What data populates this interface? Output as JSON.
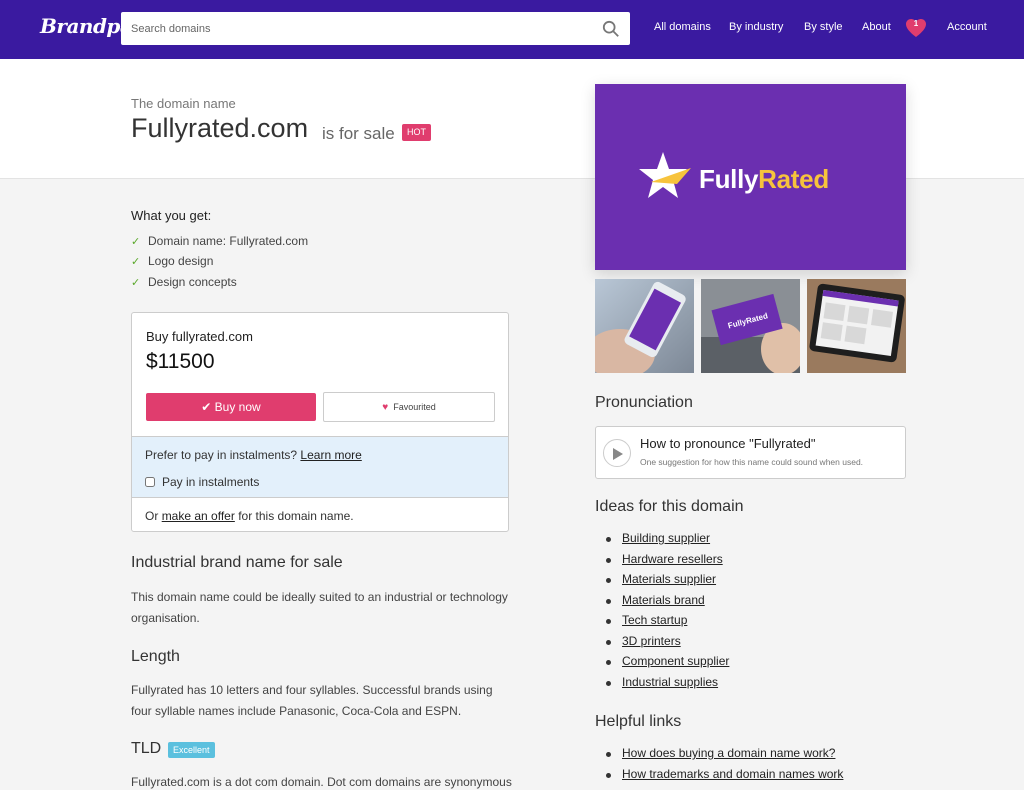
{
  "header": {
    "logo": "Brandpa",
    "search_placeholder": "Search domains",
    "nav": [
      "All domains",
      "By industry",
      "By style",
      "About"
    ],
    "favourites_count": "1",
    "account": "Account"
  },
  "hero": {
    "pre": "The domain name",
    "domain": "Fullyrated.com",
    "suffix": "is for sale",
    "badge": "HOT"
  },
  "logo_image": {
    "text_white": "Fully",
    "text_gold": "Rated",
    "bg_color": "#6b2fb0",
    "accent": "#f7c33c"
  },
  "mockups": {
    "card_text": "FullyRated"
  },
  "what_you_get": {
    "title": "What you get:",
    "items": [
      "Domain name: Fullyrated.com",
      "Logo design",
      "Design concepts"
    ]
  },
  "buy": {
    "title": "Buy fullyrated.com",
    "price": "$11500",
    "buy_label": "Buy now",
    "fav_label": "Favourited",
    "instalments_question": "Prefer to pay in instalments?",
    "learn_more": "Learn more",
    "pay_instalments": "Pay in instalments",
    "offer_pre": "Or",
    "offer_link": "make an offer",
    "offer_post": "for this domain name."
  },
  "sections": {
    "industrial_title": "Industrial brand name for sale",
    "industrial_text": "This domain name could be ideally suited to an industrial or technology organisation.",
    "length_title": "Length",
    "length_text": "Fullyrated has 10 letters and four syllables. Successful brands using four syllable names include Panasonic, Coca-Cola and ESPN.",
    "tld_title": "TLD",
    "tld_badge": "Excellent",
    "tld_text": "Fullyrated.com is a dot com domain. Dot com domains are synonymous"
  },
  "pronunciation": {
    "title": "Pronunciation",
    "card_title": "How to pronounce \"Fullyrated\"",
    "card_sub": "One suggestion for how this name could sound when used."
  },
  "ideas": {
    "title": "Ideas for this domain",
    "items": [
      "Building supplier",
      "Hardware resellers",
      "Materials supplier",
      "Materials brand",
      "Tech startup",
      "3D printers",
      "Component supplier",
      "Industrial supplies"
    ]
  },
  "helpful": {
    "title": "Helpful links",
    "items": [
      "How does buying a domain name work?",
      "How trademarks and domain names work"
    ]
  }
}
